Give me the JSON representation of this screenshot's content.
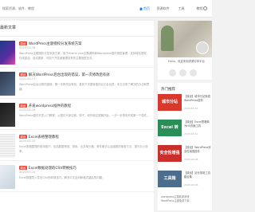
{
  "header": {
    "search_placeholder": "搜索资源、软件、教程",
    "nav": [
      {
        "label": "首页",
        "active": true
      },
      {
        "label": "资源软件",
        "active": false
      },
      {
        "label": "工具",
        "active": false
      },
      {
        "label": "教程",
        "active": false
      }
    ]
  },
  "main": {
    "section_title": "最新文章",
    "articles": [
      {
        "tag": "原创",
        "title": "WordPress主题授权分发系统方案",
        "meta": "2020-03-18",
        "excerpt": "WordPress主题授权分发系统方案，用于theme.com主题源码和Wordpress插件授权管理，支持域名授权、在线激活、自动更新，可用于开发者管理自有的主题授权业务。"
      },
      {
        "tag": "原创",
        "title": "解决WordPress后台出现的错误，第一次修改后有效",
        "meta": "2020-03-17",
        "excerpt": "WordPress后台出现的错误，第一次修改后有效，直到下次更新插件后又会出现，本文记录了解决的办法和思路。"
      },
      {
        "tag": "原创",
        "title": "开发wordpress插件的教程",
        "meta": "2020-03-16",
        "excerpt": "WordPress插件开发入门教程，从插件头部注释、钩子、动作和过滤器开始，一步一步带你完成第一个插件。"
      },
      {
        "tag": "原创",
        "title": "Excel表格整理教程",
        "meta": "2020-03-15",
        "excerpt": "Excel表格整理的常用技巧，包括数据筛选、排序、合并单元格、条件格式以及函数的使用方法，提升办公效率。"
      },
      {
        "tag": "原创",
        "title": "Excel数据处理的CSV转换技巧",
        "meta": "2020-03-14",
        "excerpt": "Excel数据导入导出CSV的转换技巧，解决中文乱码和格式错乱的问题。"
      }
    ]
  },
  "sidebar": {
    "profile_text": "Hello，欢迎来到资源分享平台",
    "hot_title": "热门推荐",
    "hot_items": [
      {
        "thumb": "城市分站",
        "color": "#d9392c",
        "text": "【原创】城市分站系统 WordPress插件",
        "meta": "2020-03-12"
      },
      {
        "thumb": "Excel 转 H5",
        "color": "#2a8f56",
        "text": "【原创】Excel表格转为H5页面工具",
        "meta": "2020-03-10"
      },
      {
        "thumb": "安全性增强",
        "color": "#c9302c",
        "text": "【原创】WordPress安全性增强插件",
        "meta": "2020-03-08"
      },
      {
        "thumb": "工具箱",
        "color": "#4c6d8c",
        "text": "【原创】站长常用工具箱合集",
        "meta": "2020-03-06"
      }
    ],
    "mini_list": [
      "wordpress主题收费系统",
      "WordPress主题免费下载"
    ]
  }
}
